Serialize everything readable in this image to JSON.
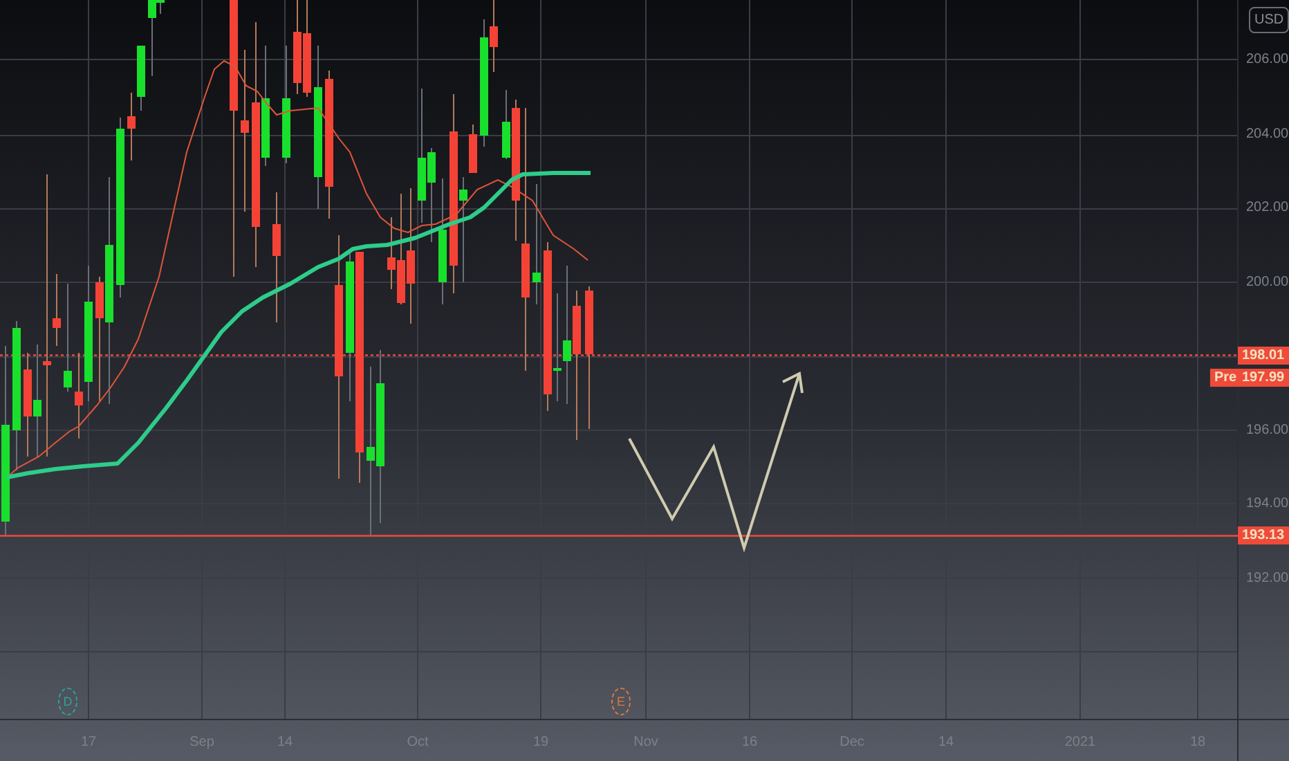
{
  "price_axis": {
    "currency": "USD",
    "ticks": [
      "206.00",
      "204.00",
      "202.00",
      "200.00",
      "196.00",
      "194.00",
      "192.00"
    ]
  },
  "price_labels": [
    {
      "kind": "last",
      "text": "198.01"
    },
    {
      "kind": "pre",
      "tag": "Pre",
      "text": "197.99"
    },
    {
      "kind": "level",
      "text": "193.13"
    }
  ],
  "events": [
    {
      "letter": "D",
      "color": "#26a69a"
    },
    {
      "letter": "E",
      "color": "#e0773a"
    }
  ],
  "time_axis": [
    "17",
    "Sep",
    "14",
    "Oct",
    "19",
    "Nov",
    "16",
    "Dec",
    "14",
    "2021",
    "18"
  ]
}
